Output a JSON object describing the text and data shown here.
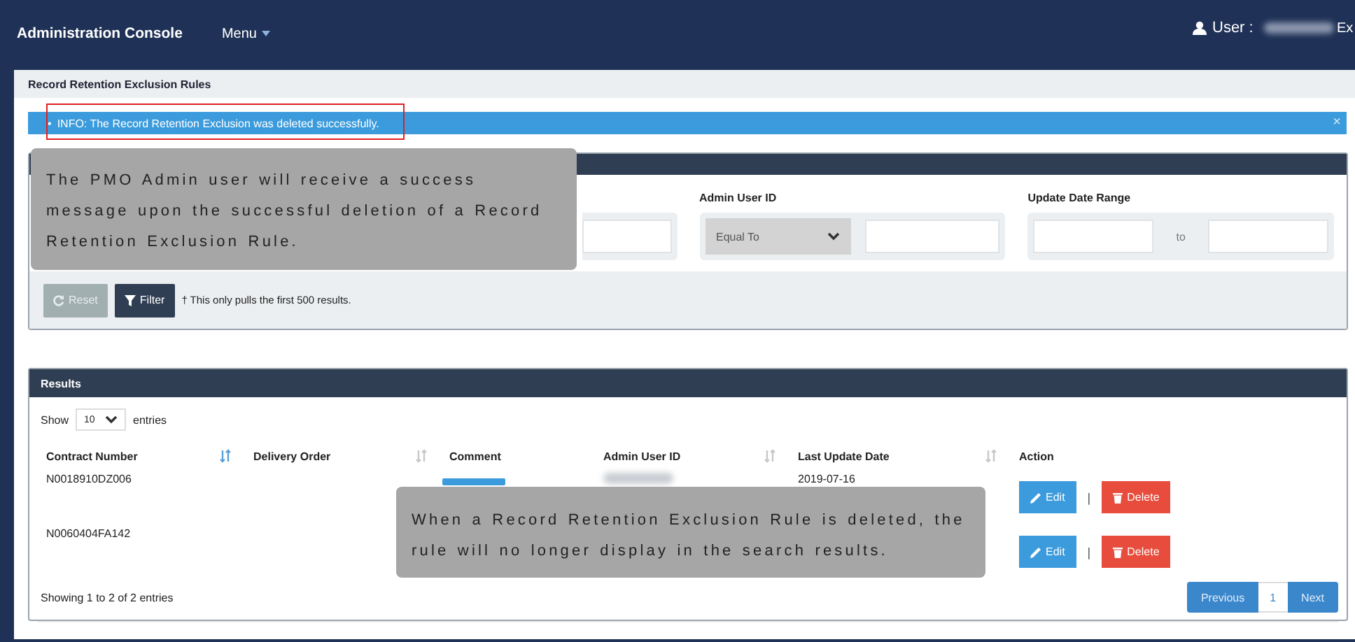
{
  "header": {
    "title": "Administration Console",
    "menu": "Menu",
    "user_label": "User :",
    "user_name_blurred": true,
    "cut_text": "Ex"
  },
  "breadcrumb": "Record Retention Exclusion Rules",
  "alert": {
    "bullet": "•",
    "text": "INFO: The Record Retention Exclusion was deleted successfully.",
    "close": "×",
    "highlighted": true
  },
  "filters": [
    {
      "kind": "text"
    },
    {
      "kind": "select_text",
      "label": "Admin User ID",
      "operator": "Equal To"
    },
    {
      "kind": "range",
      "label": "Update Date Range",
      "separator": "to"
    }
  ],
  "buttons": [
    {
      "kind": "reset",
      "label": "Reset",
      "disabled": true
    },
    {
      "kind": "filter",
      "label": "Filter",
      "disabled": false
    }
  ],
  "filter_note": "† This only pulls the first 500 results.",
  "results": {
    "title": "Results",
    "show_label": "Show",
    "page_size": "10",
    "entries_label": "entries",
    "columns": [
      {
        "label": "Contract Number",
        "sorted": true
      },
      {
        "label": "Delivery Order",
        "sorted": false
      },
      {
        "label": "Comment"
      },
      {
        "label": "Admin User ID",
        "sorted": false
      },
      {
        "label": "Last Update Date",
        "sorted": false
      },
      {
        "label": "Action"
      }
    ],
    "rows": [
      {
        "contract_number": "N0018910DZ006",
        "comment_button": true,
        "admin_id_blurred": true,
        "last_update": "2019-07-16",
        "actions": [
          {
            "kind": "edit",
            "label": "Edit"
          },
          {
            "kind": "delete",
            "label": "Delete"
          }
        ],
        "separator": "|"
      },
      {
        "contract_number": "N0060404FA142",
        "actions": [
          {
            "kind": "edit",
            "label": "Edit"
          },
          {
            "kind": "delete",
            "label": "Delete"
          }
        ],
        "separator": "|"
      }
    ],
    "summary": "Showing 1 to 2 of 2 entries",
    "pagination": [
      {
        "label": "Previous",
        "kind": "nav",
        "selected": false
      },
      {
        "label": "1",
        "kind": "page",
        "selected": true
      },
      {
        "label": "Next",
        "kind": "nav",
        "selected": false
      }
    ]
  },
  "callouts": [
    {
      "text": "The PMO Admin user will receive a success message upon the successful deletion of a Record Retention Exclusion Rule."
    },
    {
      "text": "When a Record Retention Exclusion Rule is deleted, the rule will no longer display in the search results."
    }
  ]
}
